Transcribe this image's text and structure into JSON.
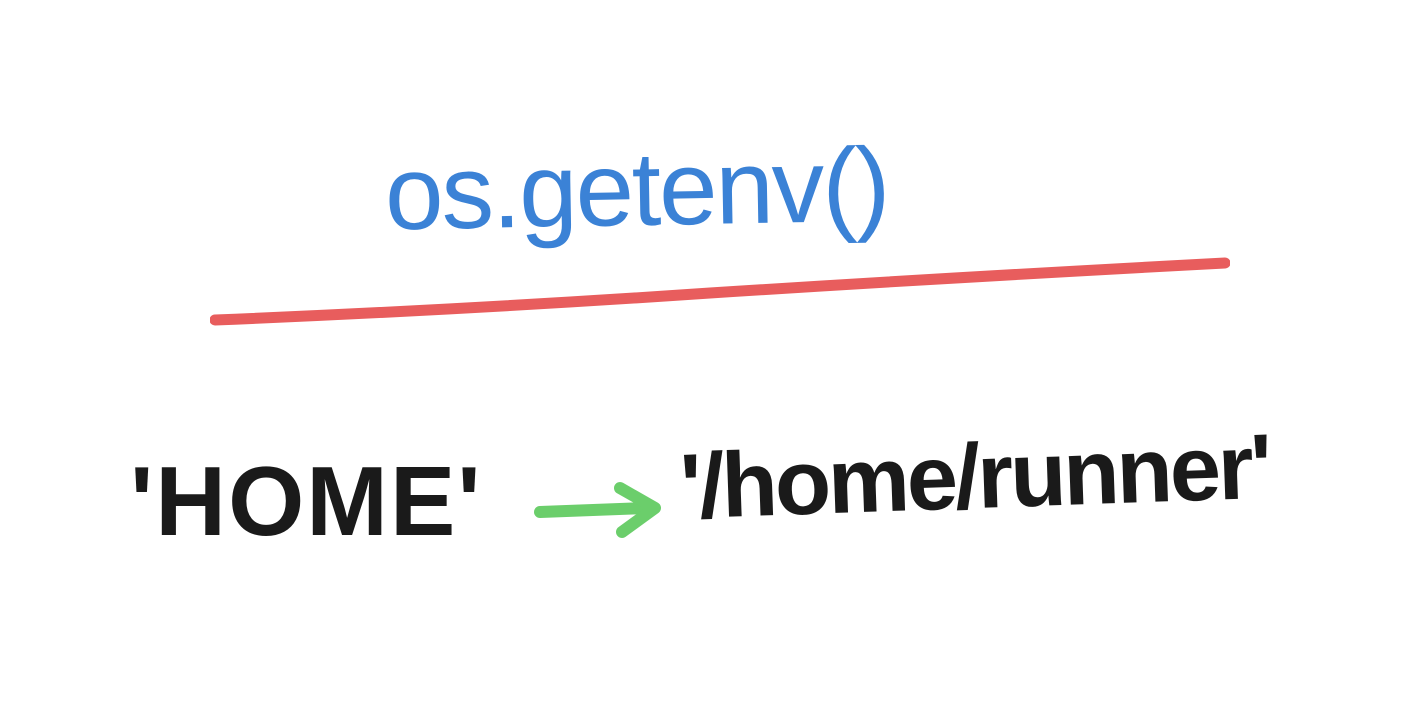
{
  "diagram": {
    "title": "os.getenv()",
    "input": "'HOME'",
    "output": "'/home/runner'",
    "colors": {
      "title": "#3b82d6",
      "underline": "#e85d5d",
      "arrow": "#6bce6b",
      "text": "#1a1a1a"
    }
  }
}
